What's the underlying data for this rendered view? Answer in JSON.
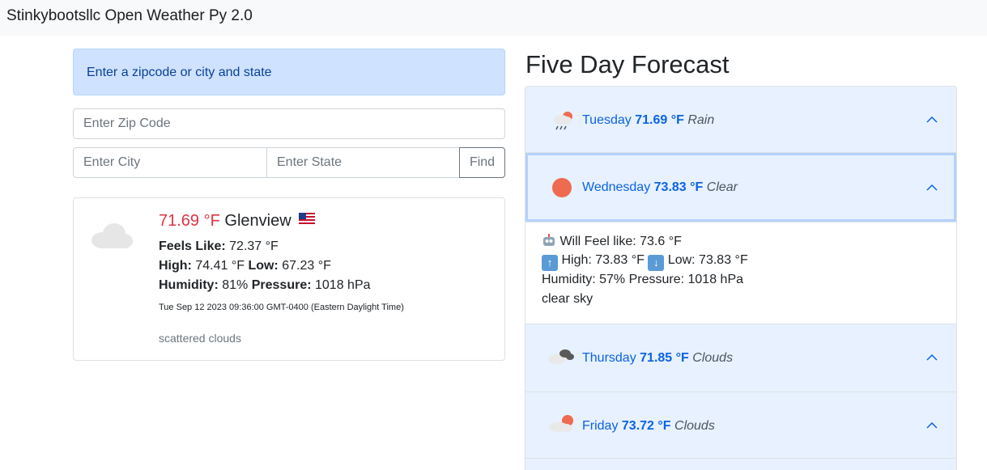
{
  "app": {
    "title": "Stinkybootsllc Open Weather Py 2.0"
  },
  "search": {
    "prompt": "Enter a zipcode or city and state",
    "zip_placeholder": "Enter Zip Code",
    "city_placeholder": "Enter City",
    "state_placeholder": "Enter State",
    "find_label": "Find"
  },
  "current": {
    "temp": "71.69 °F",
    "city": "Glenview",
    "flag": "🇺🇸",
    "icon": "cloud-icon",
    "feels_like_label": "Feels Like:",
    "feels_like": "72.37 °F",
    "high_label": "High:",
    "high": "74.41 °F",
    "low_label": "Low:",
    "low": "67.23 °F",
    "humidity_label": "Humidity:",
    "humidity": "81%",
    "pressure_label": "Pressure:",
    "pressure": "1018 hPa",
    "datetime": "Tue Sep 12 2023 09:36:00 GMT-0400 (Eastern Daylight Time)",
    "description": "scattered clouds"
  },
  "forecast": {
    "title": "Five Day Forecast",
    "days": [
      {
        "day": "Tuesday",
        "temp": "71.69 °F",
        "condition": "Rain",
        "icon": "rain-icon"
      },
      {
        "day": "Wednesday",
        "temp": "73.83 °F",
        "condition": "Clear",
        "icon": "sun-icon",
        "details": {
          "feel": "Will Feel like: 73.6 °F",
          "high": "High: 73.83 °F",
          "low": "Low: 73.83 °F",
          "humidity_pressure": "Humidity: 57% Pressure: 1018 hPa",
          "description": "clear sky"
        }
      },
      {
        "day": "Thursday",
        "temp": "71.85 °F",
        "condition": "Clouds",
        "icon": "clouds-icon"
      },
      {
        "day": "Friday",
        "temp": "73.72 °F",
        "condition": "Clouds",
        "icon": "partly-cloudy-icon"
      }
    ]
  },
  "colors": {
    "temp_current": "#dc3545",
    "accordion_bg": "#e7f1ff",
    "accordion_text": "#0c63e4",
    "alert_bg": "#cfe2ff"
  }
}
